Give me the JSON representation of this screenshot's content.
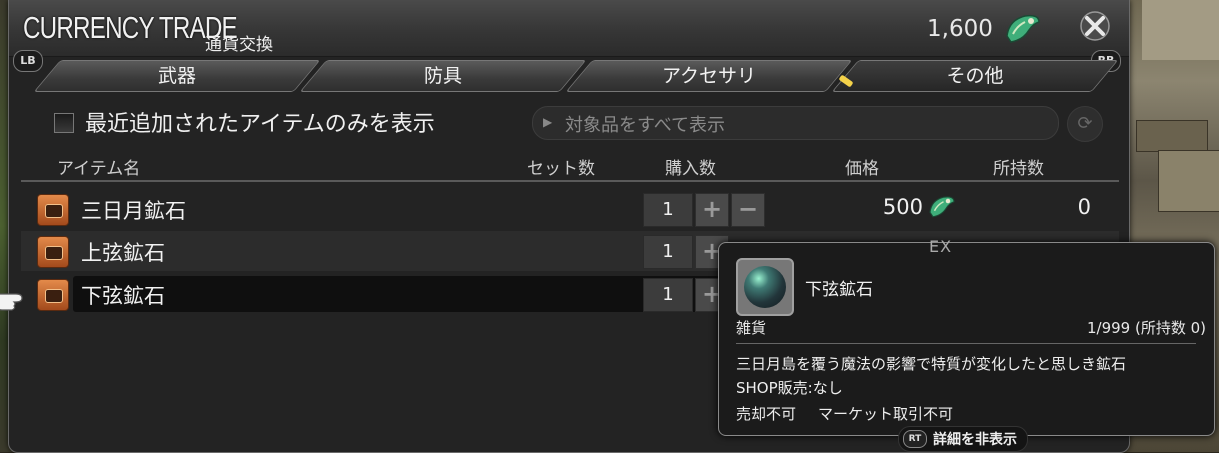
{
  "window": {
    "title": "CURRENCY TRADE",
    "subtitle": "通貨交換",
    "currency_amount": "1,600",
    "lb_label": "LB",
    "rb_label": "RB"
  },
  "tabs": [
    {
      "label": "武器"
    },
    {
      "label": "防具"
    },
    {
      "label": "アクセサリ"
    },
    {
      "label": "その他"
    }
  ],
  "filter": {
    "checkbox_label": "最近追加されたアイテムのみを表示",
    "dropdown_value": "対象品をすべて表示"
  },
  "columns": {
    "item_name": "アイテム名",
    "set_count": "セット数",
    "purchase_qty": "購入数",
    "price": "価格",
    "owned": "所持数"
  },
  "items": [
    {
      "name": "三日月鉱石",
      "qty": "1",
      "price": "500",
      "owned": "0"
    },
    {
      "name": "上弦鉱石",
      "qty": "1"
    },
    {
      "name": "下弦鉱石",
      "qty": "1"
    }
  ],
  "tooltip": {
    "badge": "EX",
    "name": "下弦鉱石",
    "category": "雑貨",
    "stack": "1/999 (所持数 0)",
    "description": "三日月島を覆う魔法の影響で特質が変化したと思しき鉱石",
    "shop": "SHOP販売:なし",
    "flag_sell": "売却不可",
    "flag_market": "マーケット取引不可"
  },
  "hint": {
    "button": "RT",
    "label": "詳細を非表示"
  },
  "colors": {
    "window_bg": "#232323",
    "selected_row": "#0f0f0f",
    "tab_marker": "#f4d24a"
  }
}
